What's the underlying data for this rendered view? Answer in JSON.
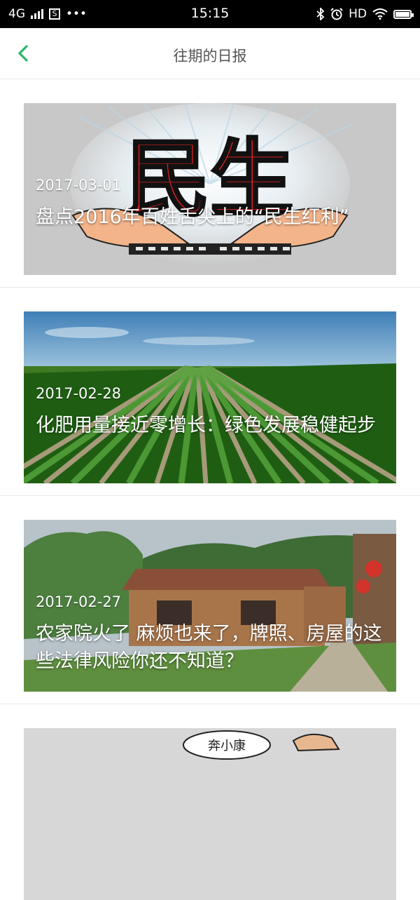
{
  "status_bar": {
    "network": "4G",
    "sim_icon": "S",
    "more": "•••",
    "time": "15:15",
    "hd": "HD"
  },
  "nav": {
    "title": "往期的日报"
  },
  "articles": [
    {
      "date": "2017-03-01",
      "title": "盘点2016年百姓舌尖上的“民生红利”",
      "image_text": "民生"
    },
    {
      "date": "2017-02-28",
      "title": "化肥用量接近零增长：绿色发展稳健起步"
    },
    {
      "date": "2017-02-27",
      "title": "农家院火了 麻烦也来了，牌照、房屋的这些法律风险你还不知道？"
    },
    {
      "image_text": "奔小康"
    }
  ],
  "colors": {
    "accent": "#2bb56b",
    "status_bar": "#000000",
    "title_text": "#555555"
  }
}
